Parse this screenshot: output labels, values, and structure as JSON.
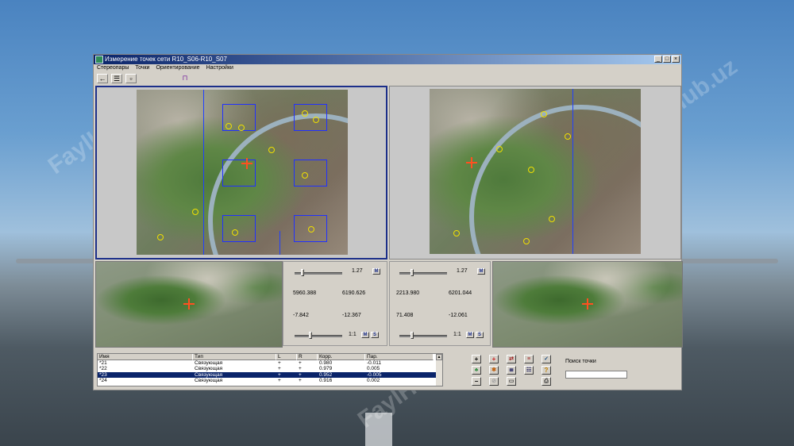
{
  "watermark": "FaylHub.uz",
  "window": {
    "title": "Измерение точек сети R10_S06-R10_S07",
    "menu": [
      "Стереопары",
      "Точки",
      "Ориентирование",
      "Настройки"
    ]
  },
  "left_controls": {
    "zoom_value": "1.27",
    "x": "5960.388",
    "y": "6190.626",
    "z": "-7.842",
    "w": "-12.367",
    "scale": "1:1",
    "m_label": "M",
    "s_label": "S"
  },
  "right_controls": {
    "zoom_value": "1.27",
    "x": "2213.980",
    "y": "6201.044",
    "z": "71.408",
    "w": "-12.061",
    "scale": "1:1",
    "m_label": "M",
    "s_label": "S"
  },
  "table": {
    "columns": [
      "Имя",
      "Тип",
      "L",
      "R",
      "Корр.",
      "Пар."
    ],
    "rows": [
      [
        "*21",
        "Связующая",
        "+",
        "+",
        "0.980",
        "-0.011"
      ],
      [
        "*22",
        "Связующая",
        "+",
        "+",
        "0.979",
        "0.005"
      ],
      [
        "*23",
        "Связующая",
        "+",
        "+",
        "0.952",
        "-0.005"
      ],
      [
        "*24",
        "Связующая",
        "+",
        "+",
        "0.916",
        "0.002"
      ]
    ],
    "selected_index": 2
  },
  "search": {
    "label": "Поиск точки",
    "value": ""
  },
  "colors": {
    "title_start": "#0a246a",
    "title_end": "#a6caf0",
    "selection": "#0a246a",
    "measure_box": "#2030ff",
    "point": "#f0e000",
    "cursor": "#ff5020"
  },
  "icons": {
    "toolbar": [
      "arrow-left-icon",
      "list-icon",
      "grid-icon",
      "chart-icon"
    ],
    "side_buttons": [
      "plus-icon",
      "plus-red-icon",
      "image-move-icon",
      "image-list-icon",
      "check-list-icon",
      "tree-icon",
      "star-icon",
      "layers-icon",
      "layers-list-icon",
      "help-icon",
      "minus-icon",
      "disabled-icon",
      "image-small-icon",
      "print-icon"
    ]
  }
}
